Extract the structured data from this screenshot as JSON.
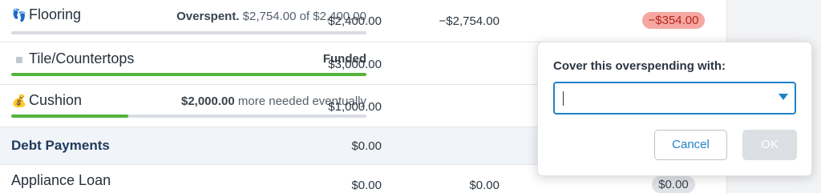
{
  "categories": [
    {
      "icon": "footprints-icon",
      "icon_glyph": "👣",
      "name": "Flooring",
      "status_bold": "Overspent.",
      "status_text": " $2,754.00 of $2,400.00",
      "progress_fraction": 1.0,
      "progress_color": "#d9dde2",
      "budgeted": "$2,400.00",
      "activity": "−$2,754.00",
      "available": "−$354.00"
    },
    {
      "icon": "square-icon",
      "icon_glyph": "◼",
      "name": "Tile/Countertops",
      "status_bold": "Funded",
      "status_text": "",
      "progress_fraction": 1.0,
      "progress_color": "#52b43a",
      "budgeted": "$3,000.00"
    },
    {
      "icon": "money-bag-icon",
      "icon_glyph": "💰",
      "name": "Cushion",
      "status_bold": "$2,000.00",
      "status_text": " more needed eventually",
      "progress_fraction": 0.33,
      "progress_color": "#52b43a",
      "budgeted": "$1,000.00"
    }
  ],
  "group": {
    "name": "Debt Payments",
    "budgeted": "$0.00"
  },
  "loan": {
    "name": "Appliance Loan",
    "budgeted": "$0.00",
    "activity": "$0.00",
    "available": "$0.00"
  },
  "popover": {
    "title": "Cover this overspending with:",
    "select_value": "",
    "cancel_label": "Cancel",
    "ok_label": "OK"
  },
  "colors": {
    "accent": "#1f82c8",
    "overspent_pill_bg": "#f5a8a1",
    "overspent_pill_text": "#b3271b",
    "progress_green": "#52b43a"
  }
}
